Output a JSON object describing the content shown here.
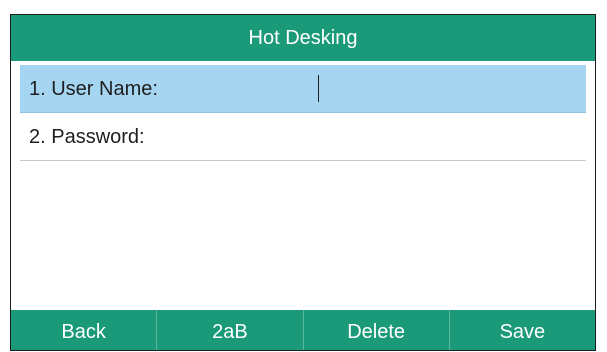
{
  "screen": {
    "title": "Hot Desking"
  },
  "fields": {
    "user_name": {
      "label": "1. User Name:",
      "value": ""
    },
    "password": {
      "label": "2. Password:",
      "value": ""
    }
  },
  "softkeys": {
    "back": "Back",
    "input_mode": "2aB",
    "delete": "Delete",
    "save": "Save"
  },
  "colors": {
    "header_bg": "#1a9a78",
    "selected_field_bg": "#a6d5f2",
    "softkey_text": "#ffffff"
  }
}
